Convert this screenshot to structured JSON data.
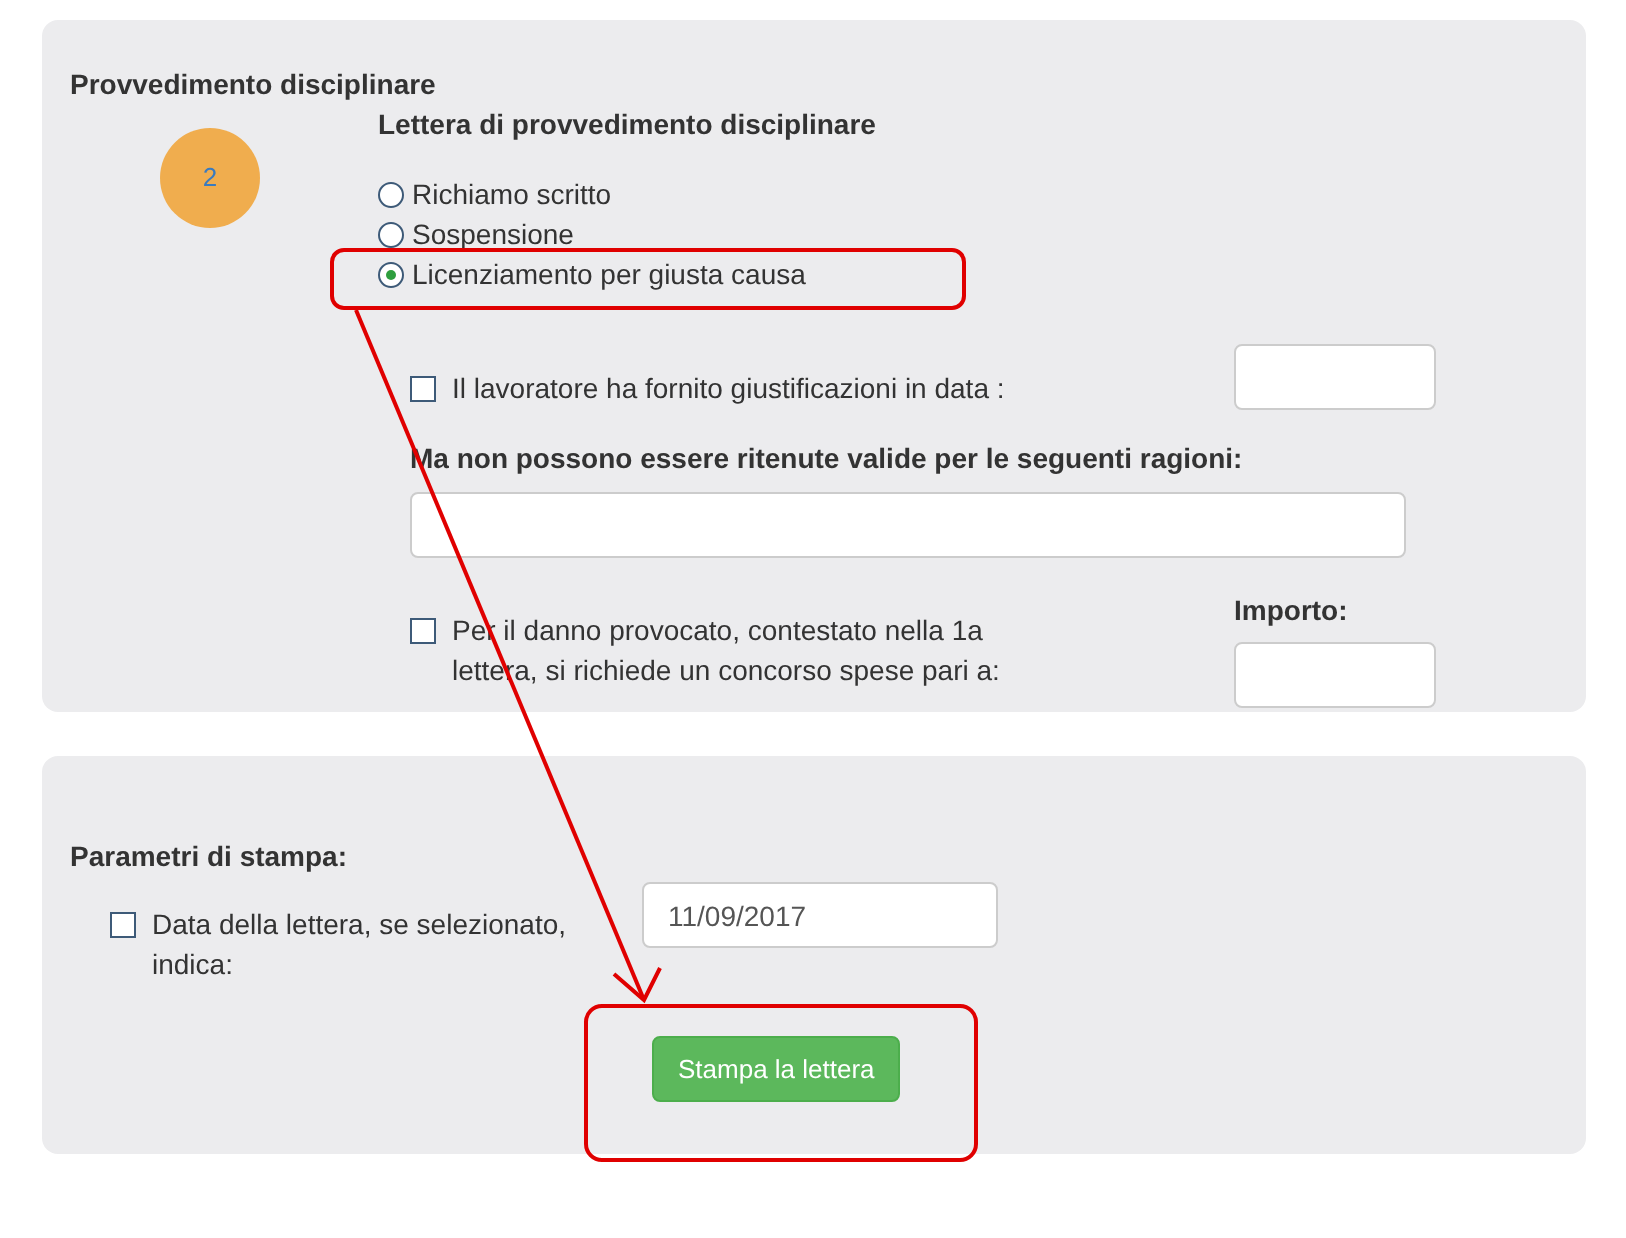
{
  "section": {
    "title": "Provvedimento disciplinare",
    "step_badge": "2",
    "subtitle": "Lettera di provvedimento disciplinare",
    "options": [
      {
        "label": "Richiamo scritto",
        "selected": false
      },
      {
        "label": "Sospensione",
        "selected": false
      },
      {
        "label": "Licenziamento per giusta causa",
        "selected": true
      }
    ],
    "justification": {
      "label": "Il lavoratore ha fornito giustificazioni in data :",
      "checked": false
    },
    "reasons": {
      "label": "Ma non possono essere ritenute valide per le seguenti ragioni:"
    },
    "damage": {
      "label": "Per il danno provocato, contestato nella 1a lettera, si richiede un concorso spese pari a:",
      "checked": false
    },
    "amount": {
      "label": "Importo:"
    }
  },
  "print": {
    "title": "Parametri di stampa:",
    "date_option": {
      "label": "Data della lettera, se selezionato, indica:",
      "checked": false
    },
    "date_value": "11/09/2017",
    "button": "Stampa la lettera"
  }
}
